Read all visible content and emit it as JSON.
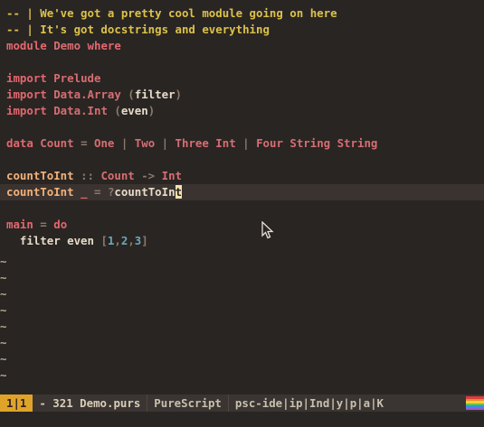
{
  "editor": {
    "lines": [
      {
        "tokens": [
          {
            "t": "-- | We've got a pretty cool module going on here",
            "c": "comment"
          }
        ]
      },
      {
        "tokens": [
          {
            "t": "-- | It's got docstrings and everything",
            "c": "comment"
          }
        ]
      },
      {
        "tokens": [
          {
            "t": "module",
            "c": "kw"
          },
          {
            "t": " Demo ",
            "c": "type"
          },
          {
            "t": "where",
            "c": "kw"
          }
        ]
      },
      {
        "tokens": []
      },
      {
        "tokens": [
          {
            "t": "import",
            "c": "kw"
          },
          {
            "t": " Prelude",
            "c": "type"
          }
        ]
      },
      {
        "tokens": [
          {
            "t": "import",
            "c": "kw"
          },
          {
            "t": " Data.Array ",
            "c": "type"
          },
          {
            "t": "(",
            "c": "op"
          },
          {
            "t": "filter",
            "c": "plain"
          },
          {
            "t": ")",
            "c": "op"
          }
        ]
      },
      {
        "tokens": [
          {
            "t": "import",
            "c": "kw"
          },
          {
            "t": " Data.Int ",
            "c": "type"
          },
          {
            "t": "(",
            "c": "op"
          },
          {
            "t": "even",
            "c": "plain"
          },
          {
            "t": ")",
            "c": "op"
          }
        ]
      },
      {
        "tokens": []
      },
      {
        "tokens": [
          {
            "t": "data",
            "c": "kw"
          },
          {
            "t": " Count ",
            "c": "type"
          },
          {
            "t": "=",
            "c": "op"
          },
          {
            "t": " One ",
            "c": "type"
          },
          {
            "t": "|",
            "c": "op"
          },
          {
            "t": " Two ",
            "c": "type"
          },
          {
            "t": "|",
            "c": "op"
          },
          {
            "t": " Three Int ",
            "c": "type"
          },
          {
            "t": "|",
            "c": "op"
          },
          {
            "t": " Four String String",
            "c": "type"
          }
        ]
      },
      {
        "tokens": []
      },
      {
        "tokens": [
          {
            "t": "countToInt",
            "c": "fn"
          },
          {
            "t": " :: ",
            "c": "op"
          },
          {
            "t": "Count",
            "c": "type"
          },
          {
            "t": " -> ",
            "c": "op"
          },
          {
            "t": "Int",
            "c": "type"
          }
        ]
      },
      {
        "tokens": [
          {
            "t": "countToInt",
            "c": "fn"
          },
          {
            "t": " ",
            "c": "plain"
          },
          {
            "t": "_",
            "c": "kw"
          },
          {
            "t": " = ",
            "c": "op"
          },
          {
            "t": "?",
            "c": "op"
          },
          {
            "t": "countToIn",
            "c": "hole"
          },
          {
            "t": "t",
            "c": "cursor"
          }
        ],
        "current": true
      },
      {
        "tokens": []
      },
      {
        "tokens": [
          {
            "t": "main",
            "c": "kw"
          },
          {
            "t": " = ",
            "c": "op"
          },
          {
            "t": "do",
            "c": "kw"
          }
        ]
      },
      {
        "tokens": [
          {
            "t": "  filter even ",
            "c": "plain"
          },
          {
            "t": "[",
            "c": "op"
          },
          {
            "t": "1",
            "c": "num"
          },
          {
            "t": ",",
            "c": "op"
          },
          {
            "t": "2",
            "c": "num"
          },
          {
            "t": ",",
            "c": "op"
          },
          {
            "t": "3",
            "c": "num"
          },
          {
            "t": "]",
            "c": "op"
          }
        ]
      }
    ],
    "tilde_rows": 8,
    "tilde_char": "~"
  },
  "statusbar": {
    "position": "1|1",
    "file": "- 321 Demo.purs",
    "mode": "PureScript",
    "plugins": "psc-ide|ip|Ind|y|p|a|K",
    "rainbow": [
      "#e03c3c",
      "#f08a2a",
      "#f2d33a",
      "#5ac05a",
      "#3a8fe0",
      "#9a5ad0"
    ]
  }
}
